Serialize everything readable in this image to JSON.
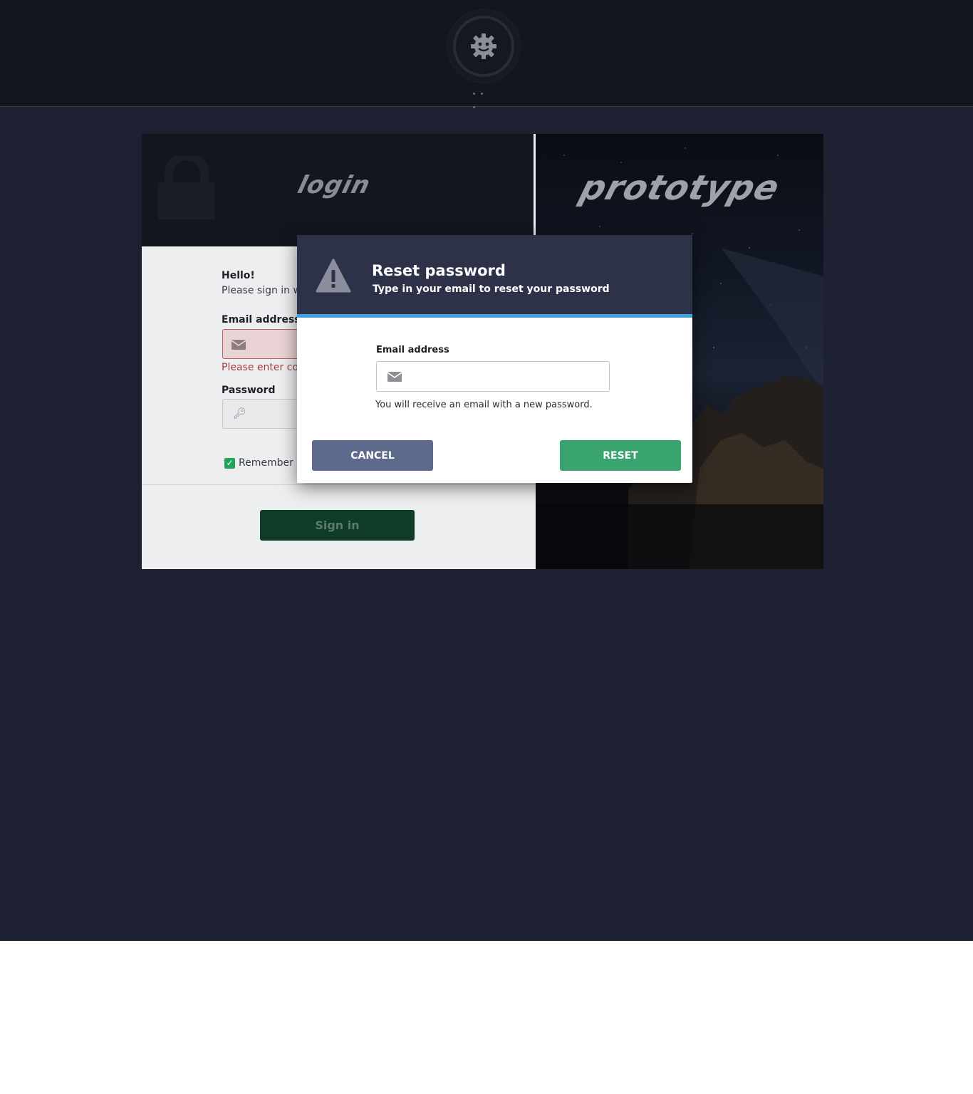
{
  "header": {
    "logo_icon": "gear-robot-icon",
    "loading_icon": "ellipsis-dots-icon"
  },
  "login_panel": {
    "heading": "login",
    "lock_icon": "lock-icon",
    "greeting": "Hello!",
    "subtitle": "Please sign in wit",
    "email_label": "Email address",
    "email_error": "Please enter corr",
    "password_label": "Password",
    "remember_label": "Remember n",
    "signin_button": "Sign in"
  },
  "brand_panel": {
    "wordmark": "prototype"
  },
  "modal": {
    "title": "Reset password",
    "subtitle": "Type in your email to reset your password",
    "warning_icon": "warning-triangle-icon",
    "email_label": "Email address",
    "email_value": "",
    "email_icon": "envelope-icon",
    "note": "You will receive an email with a new password.",
    "cancel_label": "CANCEL",
    "reset_label": "RESET"
  },
  "colors": {
    "modal_header": "#2d3249",
    "accent_bar": "#3ba3e0",
    "cancel_button": "#5e6a8c",
    "reset_button": "#3aa46e",
    "page_background": "#1d2131"
  }
}
